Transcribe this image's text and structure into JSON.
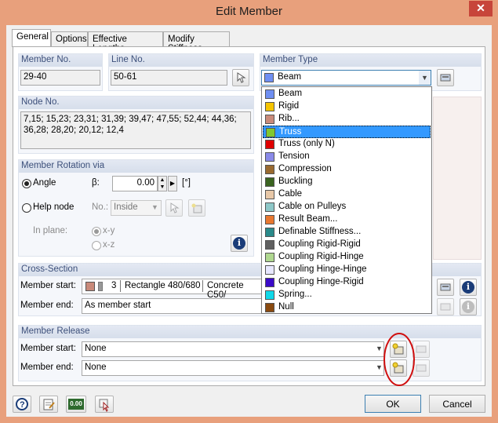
{
  "window": {
    "title": "Edit Member",
    "close": "✕"
  },
  "tabs": [
    "General",
    "Options",
    "Effective Lengths",
    "Modify Stiffness"
  ],
  "member_no": {
    "label": "Member No.",
    "value": "29-40"
  },
  "line_no": {
    "label": "Line No.",
    "value": "50-61"
  },
  "member_type": {
    "label": "Member Type",
    "selected": "Beam",
    "selected_color": "#6f8ff2",
    "options": [
      {
        "label": "Beam",
        "color": "#6f8ff2"
      },
      {
        "label": "Rigid",
        "color": "#f5c400"
      },
      {
        "label": "Rib...",
        "color": "#c98a7a"
      },
      {
        "label": "Truss",
        "color": "#80c830"
      },
      {
        "label": "Truss (only N)",
        "color": "#e00000"
      },
      {
        "label": "Tension",
        "color": "#8a8ae8"
      },
      {
        "label": "Compression",
        "color": "#9a6a30"
      },
      {
        "label": "Buckling",
        "color": "#3a6420"
      },
      {
        "label": "Cable",
        "color": "#e8c8a8"
      },
      {
        "label": "Cable on Pulleys",
        "color": "#8ec8c8"
      },
      {
        "label": "Result Beam...",
        "color": "#e87830"
      },
      {
        "label": "Definable Stiffness...",
        "color": "#2a8a8a"
      },
      {
        "label": "Coupling Rigid-Rigid",
        "color": "#606060"
      },
      {
        "label": "Coupling Rigid-Hinge",
        "color": "#b0d890"
      },
      {
        "label": "Coupling Hinge-Hinge",
        "color": "#e8e8ff"
      },
      {
        "label": "Coupling Hinge-Rigid",
        "color": "#3a0ac8"
      },
      {
        "label": "Spring...",
        "color": "#10d8e8"
      },
      {
        "label": "Null",
        "color": "#8a4a10"
      }
    ],
    "highlighted": "Truss"
  },
  "node_no": {
    "label": "Node No.",
    "line1": "7,15; 15,23; 23,31; 31,39; 39,47; 47,55; 52,44; 44,36;",
    "line2": "36,28; 28,20; 20,12; 12,4"
  },
  "rotation": {
    "label": "Member Rotation via",
    "angle_label": "Angle",
    "beta_label": "β:",
    "beta_value": "0.00",
    "unit": "[°]",
    "helpnode_label": "Help node",
    "no_label": "No.:",
    "inside_value": "Inside",
    "inplane_label": "In plane:",
    "xy_label": "x-y",
    "xz_label": "x-z"
  },
  "cross_section": {
    "label": "Cross-Section",
    "start_label": "Member start:",
    "start_color": "#c98a7a",
    "start_number": "3",
    "start_section": "Rectangle 480/680",
    "start_material": "Concrete C50/",
    "end_label": "Member end:",
    "end_value": "As member start"
  },
  "member_release": {
    "label": "Member Release",
    "start_label": "Member start:",
    "start_value": "None",
    "end_label": "Member end:",
    "end_value": "None"
  },
  "buttons": {
    "ok": "OK",
    "cancel": "Cancel"
  },
  "icons": {
    "help": "help-icon",
    "info": "i",
    "counter_text": "0.00"
  }
}
